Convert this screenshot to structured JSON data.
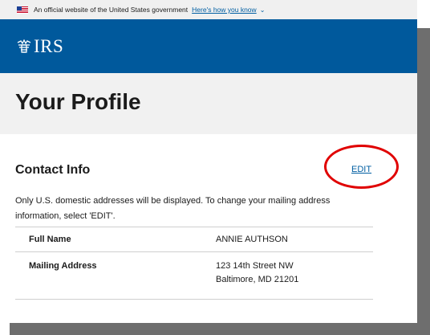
{
  "gov_banner": {
    "text": "An official website of the United States government",
    "link": "Here's how you know"
  },
  "header": {
    "logo_text": "IRS"
  },
  "page": {
    "title": "Your Profile"
  },
  "contact": {
    "section_title": "Contact Info",
    "edit_label": "EDIT",
    "note": "Only U.S. domestic addresses will be displayed. To change your mailing address information, select 'EDIT'.",
    "rows": [
      {
        "label": "Full Name",
        "value": "ANNIE AUTHSON"
      },
      {
        "label": "Mailing Address",
        "value_line1": "123 14th Street NW",
        "value_line2": "Baltimore, MD 21201"
      }
    ]
  },
  "colors": {
    "header_blue": "#00599c",
    "link_blue": "#005ea2",
    "annotation_red": "#e00000"
  }
}
